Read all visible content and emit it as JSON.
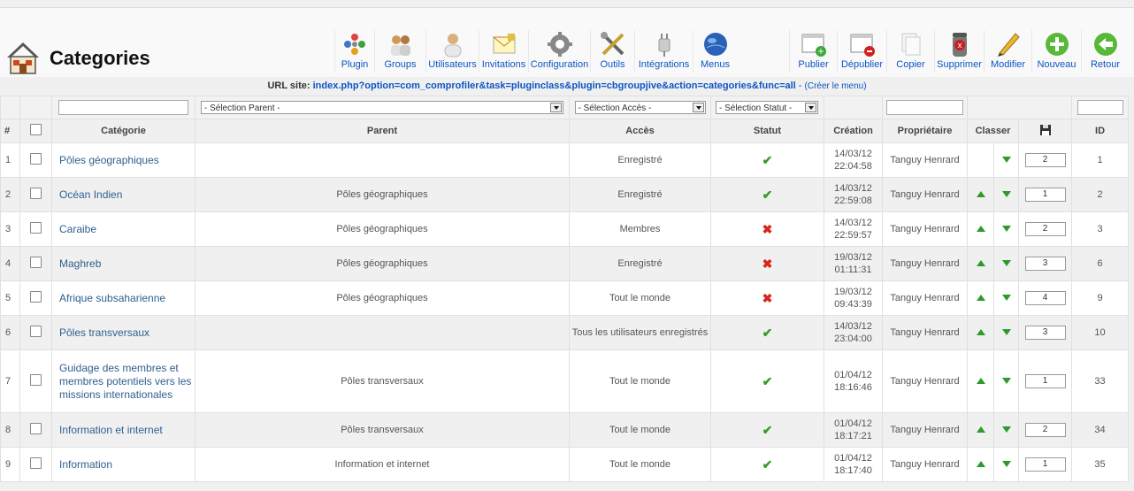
{
  "header": {
    "title": "Categories"
  },
  "toolbar_left": [
    {
      "id": "plugin",
      "label": "Plugin",
      "icon": "plugin-icon",
      "color": "#3b78c8"
    },
    {
      "id": "groups",
      "label": "Groups",
      "icon": "groups-icon",
      "color": "#d09a5a"
    },
    {
      "id": "utilisateurs",
      "label": "Utilisateurs",
      "icon": "user-icon",
      "color": "#d8b080"
    },
    {
      "id": "invitations",
      "label": "Invitations",
      "icon": "invitation-icon",
      "color": "#e0c040"
    },
    {
      "id": "configuration",
      "label": "Configuration",
      "icon": "gear-icon",
      "color": "#888888"
    },
    {
      "id": "outils",
      "label": "Outils",
      "icon": "tools-icon",
      "color": "#666666"
    },
    {
      "id": "integrations",
      "label": "Intégrations",
      "icon": "plug-icon",
      "color": "#cccccc"
    },
    {
      "id": "menus",
      "label": "Menus",
      "icon": "globe-icon",
      "color": "#2a62b8"
    }
  ],
  "toolbar_right": [
    {
      "id": "publier",
      "label": "Publier",
      "icon": "publish-icon",
      "color": "#3aa83a"
    },
    {
      "id": "depublier",
      "label": "Dépublier",
      "icon": "unpublish-icon",
      "color": "#d02020"
    },
    {
      "id": "copier",
      "label": "Copier",
      "icon": "copy-icon",
      "color": "#cccccc"
    },
    {
      "id": "supprimer",
      "label": "Supprimer",
      "icon": "delete-icon",
      "color": "#cc2020"
    },
    {
      "id": "modifier",
      "label": "Modifier",
      "icon": "edit-icon",
      "color": "#e8b830"
    },
    {
      "id": "nouveau",
      "label": "Nouveau",
      "icon": "new-icon",
      "color": "#58b838"
    },
    {
      "id": "retour",
      "label": "Retour",
      "icon": "back-icon",
      "color": "#58b838"
    }
  ],
  "url_bar": {
    "label": "URL site:",
    "url": "index.php?option=com_comprofiler&task=pluginclass&plugin=cbgroupjive&action=categories&func=all",
    "separator": " - ",
    "menu_link": "(Créer le menu)"
  },
  "filters": {
    "parent": "- Sélection Parent -",
    "access": "- Sélection Accès -",
    "status": "- Sélection Statut -"
  },
  "columns": {
    "num": "#",
    "categorie": "Catégorie",
    "parent": "Parent",
    "acces": "Accès",
    "statut": "Statut",
    "creation": "Création",
    "proprietaire": "Propriétaire",
    "classer": "Classer",
    "id": "ID"
  },
  "colors": {
    "link": "#2f5f8f",
    "published": "#3a9a2a",
    "unpublished": "#d9261c"
  },
  "rows": [
    {
      "num": "1",
      "name": "Pôles géographiques",
      "parent": "",
      "access": "Enregistré",
      "published": true,
      "date": "14/03/12",
      "time": "22:04:58",
      "owner": "Tanguy Henrard",
      "up": false,
      "down": true,
      "order": "2",
      "id": "1"
    },
    {
      "num": "2",
      "name": "Océan Indien",
      "parent": "Pôles géographiques",
      "access": "Enregistré",
      "published": true,
      "date": "14/03/12",
      "time": "22:59:08",
      "owner": "Tanguy Henrard",
      "up": true,
      "down": true,
      "order": "1",
      "id": "2"
    },
    {
      "num": "3",
      "name": "Caraibe",
      "parent": "Pôles géographiques",
      "access": "Membres",
      "published": false,
      "date": "14/03/12",
      "time": "22:59:57",
      "owner": "Tanguy Henrard",
      "up": true,
      "down": true,
      "order": "2",
      "id": "3"
    },
    {
      "num": "4",
      "name": "Maghreb",
      "parent": "Pôles géographiques",
      "access": "Enregistré",
      "published": false,
      "date": "19/03/12",
      "time": "01:11:31",
      "owner": "Tanguy Henrard",
      "up": true,
      "down": true,
      "order": "3",
      "id": "6"
    },
    {
      "num": "5",
      "name": "Afrique subsaharienne",
      "parent": "Pôles géographiques",
      "access": "Tout le monde",
      "published": false,
      "date": "19/03/12",
      "time": "09:43:39",
      "owner": "Tanguy Henrard",
      "up": true,
      "down": true,
      "order": "4",
      "id": "9"
    },
    {
      "num": "6",
      "name": "Pôles transversaux",
      "parent": "",
      "access": "Tous les utilisateurs enregistrés",
      "published": true,
      "date": "14/03/12",
      "time": "23:04:00",
      "owner": "Tanguy Henrard",
      "up": true,
      "down": true,
      "order": "3",
      "id": "10"
    },
    {
      "num": "7",
      "name": "Guidage des membres et membres potentiels vers les missions internationales",
      "parent": "Pôles transversaux",
      "access": "Tout le monde",
      "published": true,
      "date": "01/04/12",
      "time": "18:16:46",
      "owner": "Tanguy Henrard",
      "up": true,
      "down": true,
      "order": "1",
      "id": "33"
    },
    {
      "num": "8",
      "name": "Information et internet",
      "parent": "Pôles transversaux",
      "access": "Tout le monde",
      "published": true,
      "date": "01/04/12",
      "time": "18:17:21",
      "owner": "Tanguy Henrard",
      "up": true,
      "down": true,
      "order": "2",
      "id": "34"
    },
    {
      "num": "9",
      "name": "Information",
      "parent": "Information et internet",
      "access": "Tout le monde",
      "published": true,
      "date": "01/04/12",
      "time": "18:17:40",
      "owner": "Tanguy Henrard",
      "up": true,
      "down": true,
      "order": "1",
      "id": "35"
    }
  ]
}
